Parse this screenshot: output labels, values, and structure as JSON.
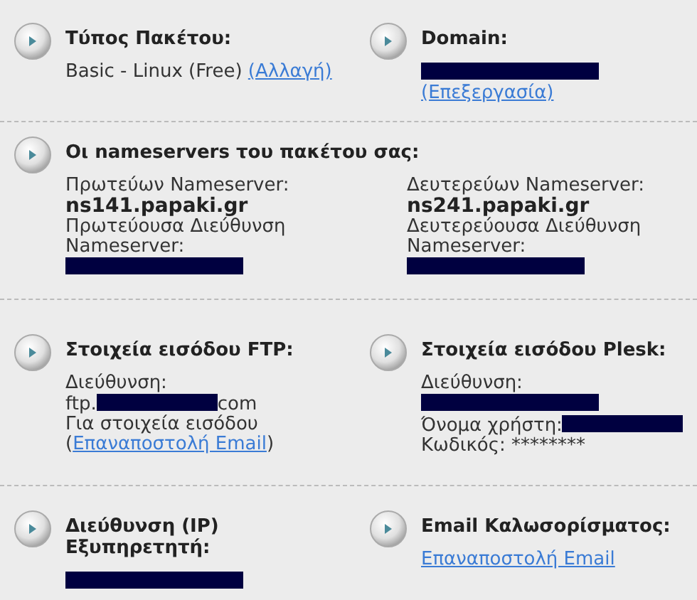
{
  "sections": [
    {
      "cells": [
        {
          "title": "Τύπος Πακέτου:",
          "lines": [
            [
              {
                "kind": "text",
                "text": "Basic - Linux (Free)"
              },
              {
                "kind": "link",
                "text": "(Αλλαγή)"
              }
            ]
          ]
        },
        {
          "title": "Domain:",
          "lines": [
            [
              {
                "kind": "redacted"
              }
            ],
            [
              {
                "kind": "link",
                "text": "(Επεξεργασία)"
              }
            ]
          ]
        }
      ]
    },
    {
      "cells": [
        {
          "title": "Οι nameservers του πακέτου σας:",
          "columns": [
            [
              [
                {
                  "kind": "text",
                  "text": "Πρωτεύων Nameserver:"
                }
              ],
              [
                {
                  "kind": "bold",
                  "text": "ns141.papaki.gr"
                }
              ],
              [
                {
                  "kind": "text",
                  "text": "Πρωτεύουσα Διεύθυνση"
                }
              ],
              [
                {
                  "kind": "text",
                  "text": "Nameserver:"
                }
              ],
              [
                {
                  "kind": "redacted"
                }
              ]
            ],
            [
              [
                {
                  "kind": "text",
                  "text": "Δευτερεύων Nameserver:"
                }
              ],
              [
                {
                  "kind": "bold",
                  "text": "ns241.papaki.gr"
                }
              ],
              [
                {
                  "kind": "text",
                  "text": "Δευτερεύουσα Διεύθυνση"
                }
              ],
              [
                {
                  "kind": "text",
                  "text": "Nameserver:"
                }
              ],
              [
                {
                  "kind": "redacted"
                }
              ]
            ]
          ]
        }
      ]
    },
    {
      "cells": [
        {
          "title": "Στοιχεία εισόδου FTP:",
          "lines": [
            [
              {
                "kind": "text",
                "text": "Διεύθυνση:"
              }
            ],
            [
              {
                "kind": "text",
                "text": "ftp."
              },
              {
                "kind": "redacted"
              },
              {
                "kind": "text",
                "text": "com"
              }
            ],
            [
              {
                "kind": "text",
                "text": "Για στοιχεία εισόδου"
              }
            ],
            [
              {
                "kind": "text",
                "text": "("
              },
              {
                "kind": "link",
                "text": "Επαναποστολή Email"
              },
              {
                "kind": "text",
                "text": ")"
              }
            ]
          ]
        },
        {
          "title": "Στοιχεία εισόδου Plesk:",
          "lines": [
            [
              {
                "kind": "text",
                "text": "Διεύθυνση:"
              }
            ],
            [
              {
                "kind": "redacted"
              }
            ],
            [
              {
                "kind": "text",
                "text": "Όνομα χρήστη:"
              },
              {
                "kind": "redacted"
              }
            ],
            [
              {
                "kind": "text",
                "text": "Κωδικός: ********"
              }
            ]
          ]
        }
      ]
    },
    {
      "cells": [
        {
          "title": "Διεύθυνση (IP) Εξυπηρετητή:",
          "lines": [
            [
              {
                "kind": "redacted"
              }
            ]
          ]
        },
        {
          "title": "Email Καλωσορίσματος:",
          "lines": [
            [
              {
                "kind": "link",
                "text": "Επαναποστολή Email"
              }
            ]
          ]
        }
      ]
    }
  ]
}
